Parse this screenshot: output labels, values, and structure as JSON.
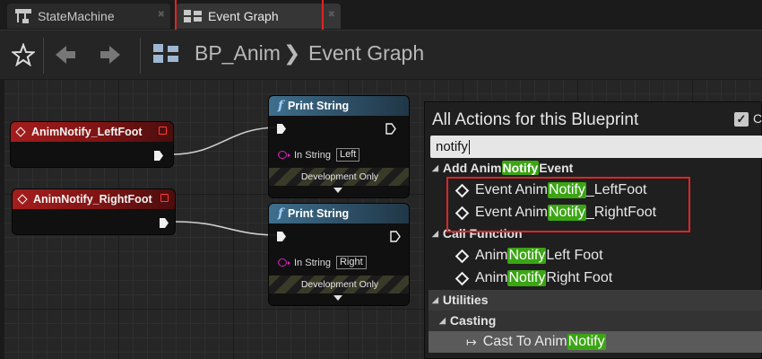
{
  "tabs": [
    {
      "label": "StateMachine",
      "icon": "state-machine-icon",
      "active": false
    },
    {
      "label": "Event Graph",
      "icon": "graph-icon",
      "active": true
    }
  ],
  "toolbar": {
    "breadcrumb_root": "BP_Anim",
    "breadcrumb_sep": "❯",
    "breadcrumb_current": "Event Graph"
  },
  "graph": {
    "event_nodes": [
      {
        "title": "AnimNotify_LeftFoot"
      },
      {
        "title": "AnimNotify_RightFoot"
      }
    ],
    "print_nodes": [
      {
        "title": "Print String",
        "in_label": "In String",
        "in_value": "Left",
        "dev_label": "Development Only"
      },
      {
        "title": "Print String",
        "in_label": "In String",
        "in_value": "Right",
        "dev_label": "Development Only"
      }
    ]
  },
  "menu": {
    "title": "All Actions for this Blueprint",
    "context_label": "C",
    "search_value": "notify",
    "categories": {
      "add_anim": {
        "pre": "Add Anim ",
        "hl": "Notify",
        "post": " Event"
      },
      "call_function": "Call Function",
      "utilities": "Utilities",
      "casting": "Casting"
    },
    "items": [
      {
        "pre": "Event Anim",
        "hl": "Notify",
        "post": "_LeftFoot"
      },
      {
        "pre": "Event Anim",
        "hl": "Notify",
        "post": "_RightFoot"
      },
      {
        "pre": "Anim ",
        "hl": "Notify",
        "post": " Left Foot"
      },
      {
        "pre": "Anim ",
        "hl": "Notify",
        "post": " Right Foot"
      },
      {
        "pre": "Cast To Anim",
        "hl": "Notify",
        "post": ""
      }
    ]
  },
  "colors": {
    "highlight_green": "#3ba514",
    "annotation_red": "#e02424",
    "event_red": "#a51d1d",
    "function_blue": "#3f6f8e",
    "string_pin_magenta": "#e31ec8"
  }
}
